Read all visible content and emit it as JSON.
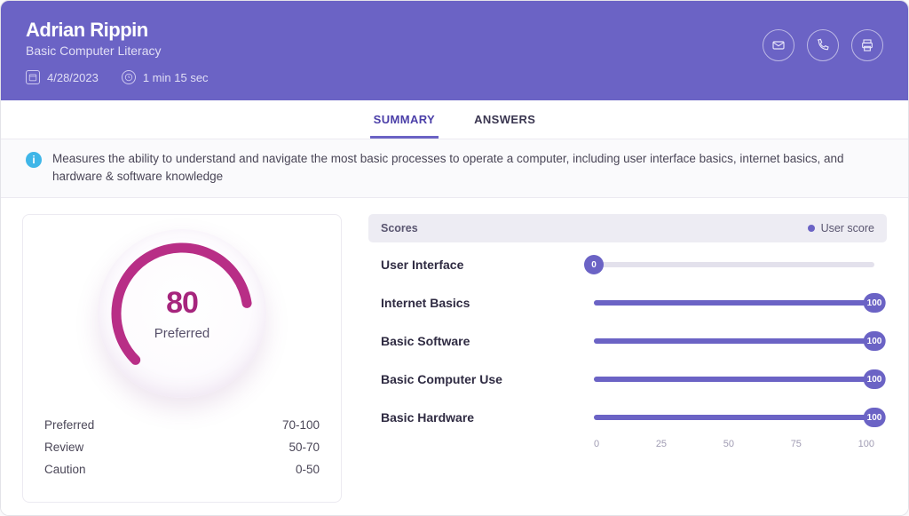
{
  "header": {
    "name": "Adrian Rippin",
    "course": "Basic Computer Literacy",
    "date": "4/28/2023",
    "duration": "1 min 15 sec"
  },
  "tabs": {
    "summary": "SUMMARY",
    "answers": "ANSWERS",
    "active": "summary"
  },
  "info": "Measures the ability to understand and navigate the most basic processes to operate a computer, including user interface basics, internet basics, and hardware & software knowledge",
  "gauge": {
    "value": 80,
    "label": "Preferred",
    "legend": [
      {
        "label": "Preferred",
        "range": "70-100"
      },
      {
        "label": "Review",
        "range": "50-70"
      },
      {
        "label": "Caution",
        "range": "0-50"
      }
    ]
  },
  "scores": {
    "title": "Scores",
    "legend_label": "User score",
    "axis": [
      "0",
      "25",
      "50",
      "75",
      "100"
    ],
    "items": [
      {
        "label": "User Interface",
        "value": 0
      },
      {
        "label": "Internet Basics",
        "value": 100
      },
      {
        "label": "Basic Software",
        "value": 100
      },
      {
        "label": "Basic Computer Use",
        "value": 100
      },
      {
        "label": "Basic Hardware",
        "value": 100
      }
    ]
  },
  "colors": {
    "brand": "#6b63c5",
    "accent": "#a6257d"
  },
  "chart_data": {
    "gauge": {
      "type": "gauge",
      "value": 80,
      "min": 0,
      "max": 100,
      "label": "Preferred",
      "bands": [
        {
          "name": "Preferred",
          "range": [
            70,
            100
          ]
        },
        {
          "name": "Review",
          "range": [
            50,
            70
          ]
        },
        {
          "name": "Caution",
          "range": [
            0,
            50
          ]
        }
      ]
    },
    "bars": {
      "type": "bar",
      "xlim": [
        0,
        100
      ],
      "ticks": [
        0,
        25,
        50,
        75,
        100
      ],
      "series_name": "User score",
      "categories": [
        "User Interface",
        "Internet Basics",
        "Basic Software",
        "Basic Computer Use",
        "Basic Hardware"
      ],
      "values": [
        0,
        100,
        100,
        100,
        100
      ]
    }
  }
}
